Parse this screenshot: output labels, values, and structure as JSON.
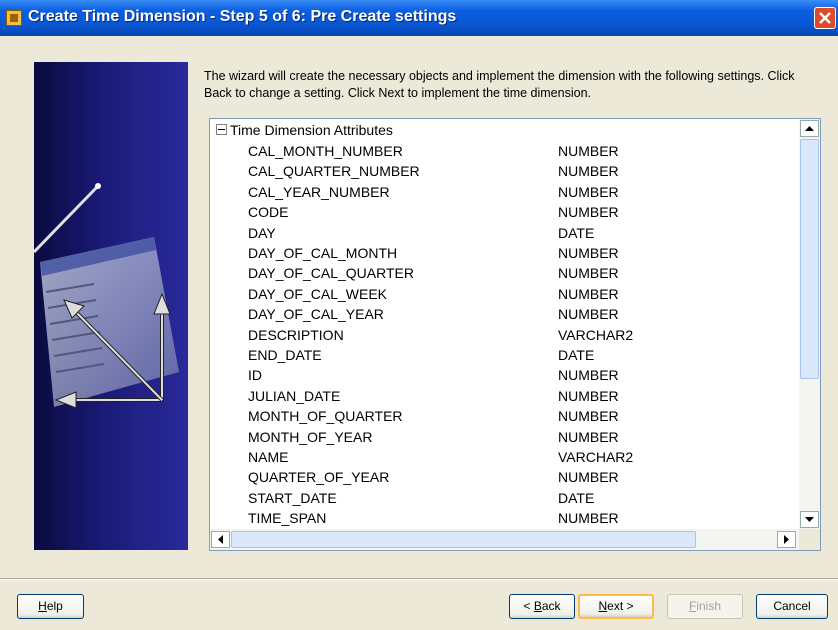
{
  "window": {
    "title": "Create Time Dimension - Step 5 of 6: Pre Create settings"
  },
  "intro": "The wizard will create the necessary objects and implement the dimension with the following settings. Click Back to change a setting. Click Next to implement the time dimension.",
  "tree": {
    "root": "Time Dimension Attributes",
    "rows": [
      {
        "name": "CAL_MONTH_NUMBER",
        "type": "NUMBER"
      },
      {
        "name": "CAL_QUARTER_NUMBER",
        "type": "NUMBER"
      },
      {
        "name": "CAL_YEAR_NUMBER",
        "type": "NUMBER"
      },
      {
        "name": "CODE",
        "type": "NUMBER"
      },
      {
        "name": "DAY",
        "type": "DATE"
      },
      {
        "name": "DAY_OF_CAL_MONTH",
        "type": "NUMBER"
      },
      {
        "name": "DAY_OF_CAL_QUARTER",
        "type": "NUMBER"
      },
      {
        "name": "DAY_OF_CAL_WEEK",
        "type": "NUMBER"
      },
      {
        "name": "DAY_OF_CAL_YEAR",
        "type": "NUMBER"
      },
      {
        "name": "DESCRIPTION",
        "type": "VARCHAR2"
      },
      {
        "name": "END_DATE",
        "type": "DATE"
      },
      {
        "name": "ID",
        "type": "NUMBER"
      },
      {
        "name": "JULIAN_DATE",
        "type": "NUMBER"
      },
      {
        "name": "MONTH_OF_QUARTER",
        "type": "NUMBER"
      },
      {
        "name": "MONTH_OF_YEAR",
        "type": "NUMBER"
      },
      {
        "name": "NAME",
        "type": "VARCHAR2"
      },
      {
        "name": "QUARTER_OF_YEAR",
        "type": "NUMBER"
      },
      {
        "name": "START_DATE",
        "type": "DATE"
      },
      {
        "name": "TIME_SPAN",
        "type": "NUMBER"
      }
    ]
  },
  "buttons": {
    "help": {
      "mnemonic": "H",
      "rest": "elp"
    },
    "back": {
      "prefix": "< ",
      "mnemonic": "B",
      "rest": "ack"
    },
    "next": {
      "mnemonic": "N",
      "rest": "ext >"
    },
    "finish": {
      "mnemonic": "F",
      "rest": "inish"
    },
    "cancel": "Cancel"
  },
  "icons": {
    "app": "wizard-app-icon",
    "close": "close-icon",
    "scroll_up": "arrow-up-icon",
    "scroll_down": "arrow-down-icon",
    "scroll_left": "arrow-left-icon",
    "scroll_right": "arrow-right-icon"
  }
}
